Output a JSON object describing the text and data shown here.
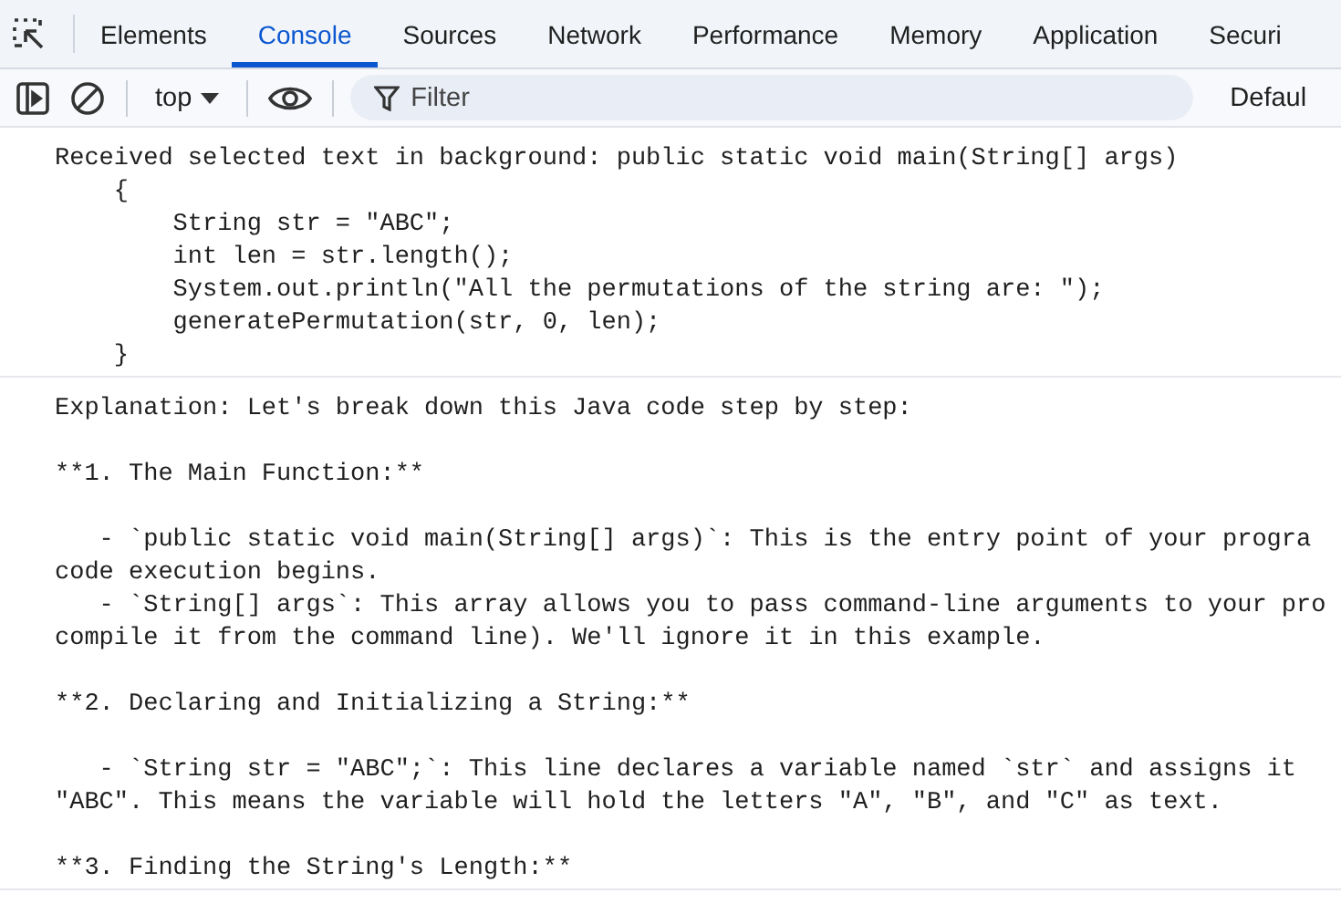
{
  "tabs": [
    {
      "label": "Elements",
      "selected": false
    },
    {
      "label": "Console",
      "selected": true
    },
    {
      "label": "Sources",
      "selected": false
    },
    {
      "label": "Network",
      "selected": false
    },
    {
      "label": "Performance",
      "selected": false
    },
    {
      "label": "Memory",
      "selected": false
    },
    {
      "label": "Application",
      "selected": false
    },
    {
      "label": "Securi",
      "selected": false
    }
  ],
  "toolbar": {
    "context": "top",
    "filter": {
      "placeholder": "Filter"
    },
    "levels": "Defaul"
  },
  "messages": [
    {
      "paragraphs": [
        "Received selected text in background: public static void main(String[] args)\n    {\n        String str = \"ABC\";\n        int len = str.length();\n        System.out.println(\"All the permutations of the string are: \");\n        generatePermutation(str, 0, len);\n    }"
      ]
    },
    {
      "paragraphs": [
        "Explanation: Let's break down this Java code step by step:",
        "**1. The Main Function:**",
        "   - `public static void main(String[] args)`: This is the entry point of your progra\ncode execution begins.\n   - `String[] args`: This array allows you to pass command-line arguments to your pro\ncompile it from the command line). We'll ignore it in this example.",
        "**2. Declaring and Initializing a String:**",
        "   - `String str = \"ABC\";`: This line declares a variable named `str` and assigns it\n\"ABC\". This means the variable will hold the letters \"A\", \"B\", and \"C\" as text.",
        "**3. Finding the String's Length:**"
      ]
    }
  ]
}
